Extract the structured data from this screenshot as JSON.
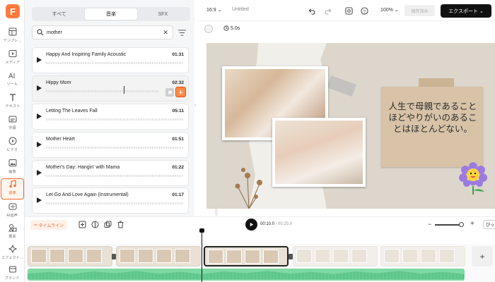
{
  "app": {
    "logo": "F"
  },
  "rail": [
    {
      "label": "テンプレ…",
      "icon": "template-icon"
    },
    {
      "label": "メディア",
      "icon": "media-icon"
    },
    {
      "label": "ツール",
      "icon": "ai-tool-icon"
    },
    {
      "label": "テキスト",
      "icon": "text-icon"
    },
    {
      "label": "字幕",
      "icon": "subtitle-icon"
    },
    {
      "label": "ビデオ",
      "icon": "video-icon"
    },
    {
      "label": "画像",
      "icon": "image-icon"
    },
    {
      "label": "音楽",
      "icon": "music-icon"
    },
    {
      "label": "AI音声",
      "icon": "ai-voice-icon"
    },
    {
      "label": "要素",
      "icon": "elements-icon"
    },
    {
      "label": "エフェクト…",
      "icon": "effects-icon"
    },
    {
      "label": "ブランド",
      "icon": "brand-icon"
    }
  ],
  "panel": {
    "tabs": [
      "すべて",
      "音楽",
      "SFX"
    ],
    "selected_tab": "音楽",
    "search": {
      "value": "mother"
    },
    "tracks": [
      {
        "title": "Happy And Inspiring Family Acoustic",
        "duration": "01:31"
      },
      {
        "title": "Hippy Mom",
        "duration": "02:32"
      },
      {
        "title": "Letting The Leaves Fall",
        "duration": "05:11"
      },
      {
        "title": "Mother Heart",
        "duration": "01:51"
      },
      {
        "title": "Mother's Day: Hangin' with Mama",
        "duration": "01:22"
      },
      {
        "title": "Let Go And Love Again (Instrumental)",
        "duration": "01:17"
      }
    ]
  },
  "topbar": {
    "ratio": "16:9",
    "title": "Untitled",
    "zoom": "100%",
    "save": "保存済み",
    "export": "エクスポート"
  },
  "subbar": {
    "duration": "5.0s"
  },
  "canvas": {
    "note_text": "人生で母親であることほどやりがいのあることはほとんどない。"
  },
  "timeline_bar": {
    "magic": "タイムライン",
    "current": "00:10.0",
    "total": "/ 00:25.0",
    "fit": "ぴっ"
  },
  "colors": {
    "accent": "#f06a2c",
    "export_bg": "#111111",
    "audio": "#7ed9a2"
  }
}
